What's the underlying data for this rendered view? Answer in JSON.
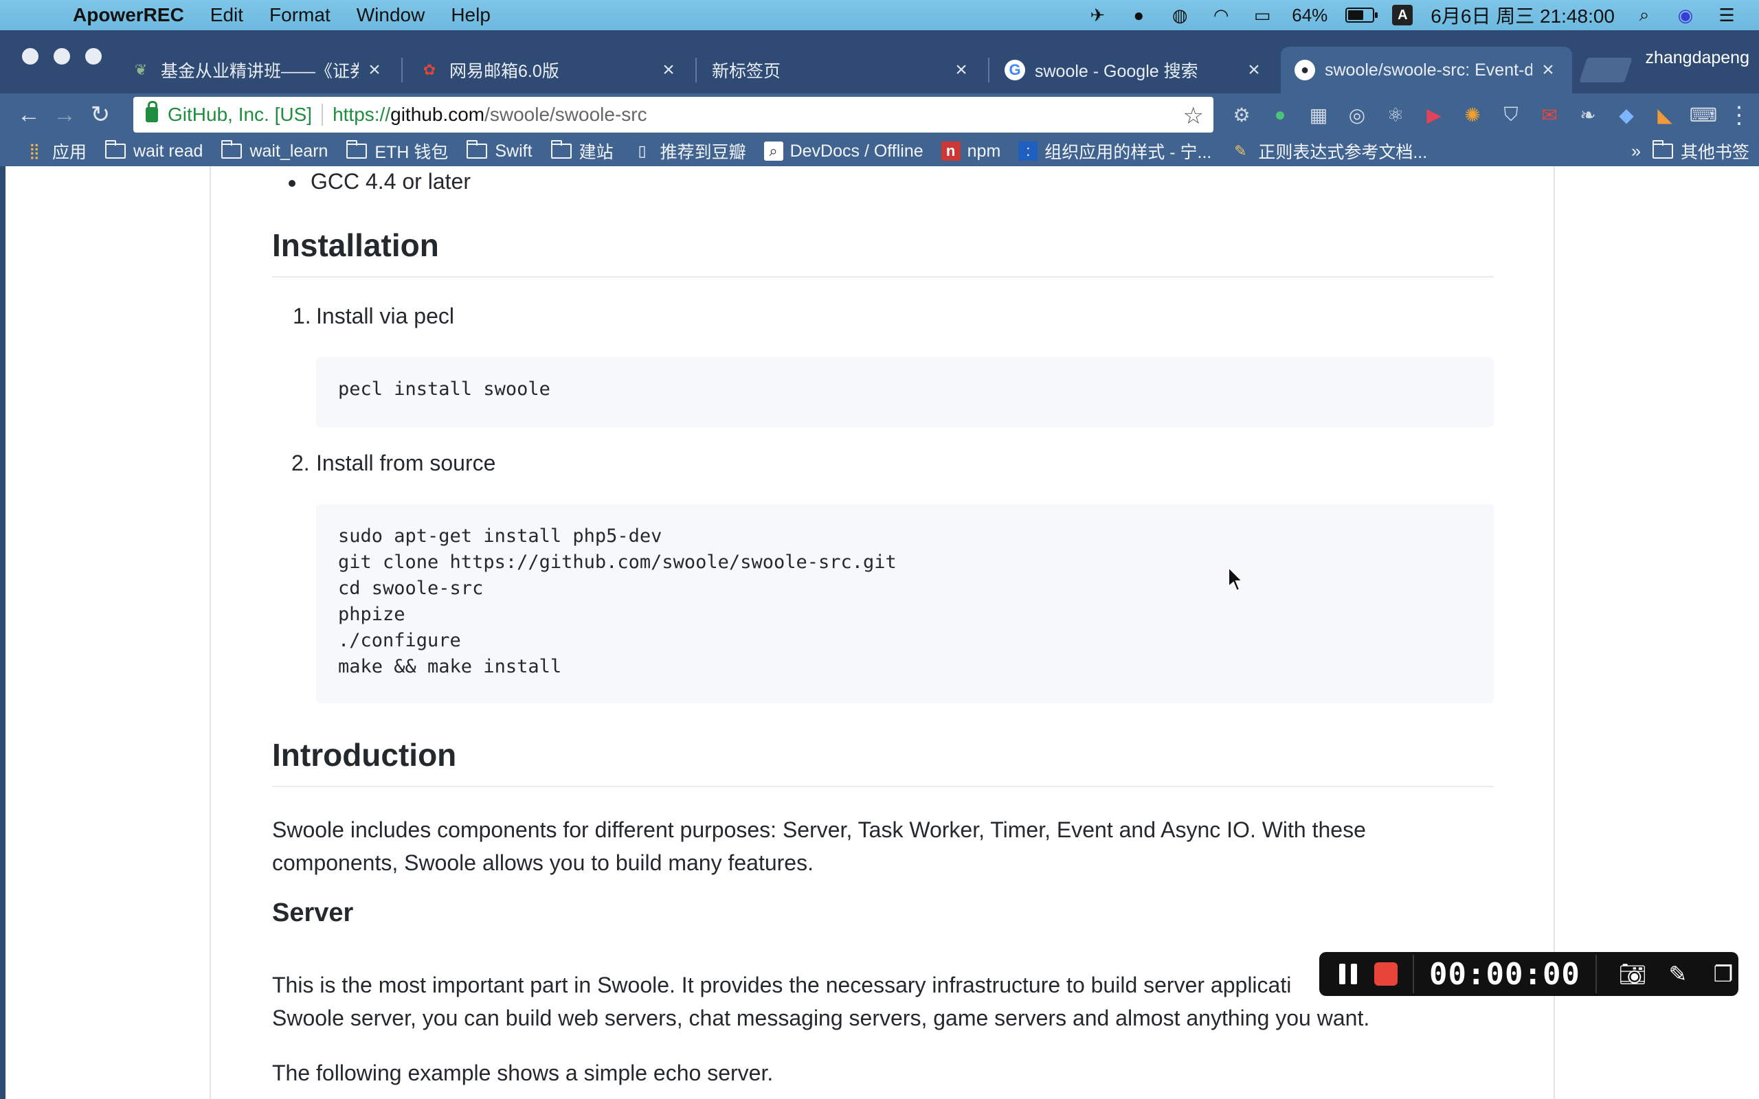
{
  "menubar": {
    "app_name": "ApowerREC",
    "items": [
      "Edit",
      "Format",
      "Window",
      "Help"
    ],
    "battery_percent": "64%",
    "battery_level": 0.64,
    "input_method": "A",
    "datetime": "6月6日 周三 21:48:00"
  },
  "tabs": [
    {
      "title": "基金从业精讲班——《证券投",
      "icon": "bookmark-leaf-icon"
    },
    {
      "title": "网易邮箱6.0版",
      "icon": "netease-mail-icon"
    },
    {
      "title": "新标签页",
      "icon": ""
    },
    {
      "title": "swoole - Google 搜索",
      "icon": "google-icon"
    },
    {
      "title": "swoole/swoole-src: Event-d",
      "icon": "github-icon"
    }
  ],
  "profile_name": "zhangdapeng",
  "omnibox": {
    "ev_name": "GitHub, Inc. [US]",
    "scheme": "https://",
    "host": "github.com",
    "path": "/swoole/swoole-src"
  },
  "bookmarks": {
    "items": [
      "应用",
      "wait read",
      "wait_learn",
      "ETH 钱包",
      "Swift",
      "建站",
      "推荐到豆瓣",
      "DevDocs / Offline",
      "npm",
      "组织应用的样式 - 宁...",
      "正则表达式参考文档..."
    ],
    "overflow": "»",
    "other": "其他书签"
  },
  "readme": {
    "bullet_gcc": "GCC 4.4 or later",
    "installation_heading": "Installation",
    "step1_label": "1.",
    "step1_text": "Install via pecl",
    "step1_code": "pecl install swoole",
    "step2_label": "2.",
    "step2_text": "Install from source",
    "step2_code": "sudo apt-get install php5-dev\ngit clone https://github.com/swoole/swoole-src.git\ncd swoole-src\nphpize\n./configure\nmake && make install",
    "introduction_heading": "Introduction",
    "intro_para": "Swoole includes components for different purposes: Server, Task Worker, Timer, Event and Async IO. With these components, Swoole allows you to build many features.",
    "server_heading": "Server",
    "server_para": "This is the most important part in Swoole. It provides the necessary infrastructure to build server applicati",
    "server_para_line2": "Swoole server, you can build web servers, chat messaging servers, game servers and almost anything you want.",
    "echo_para": "The following example shows a simple echo server."
  },
  "recorder": {
    "timer": "00:00:00"
  }
}
